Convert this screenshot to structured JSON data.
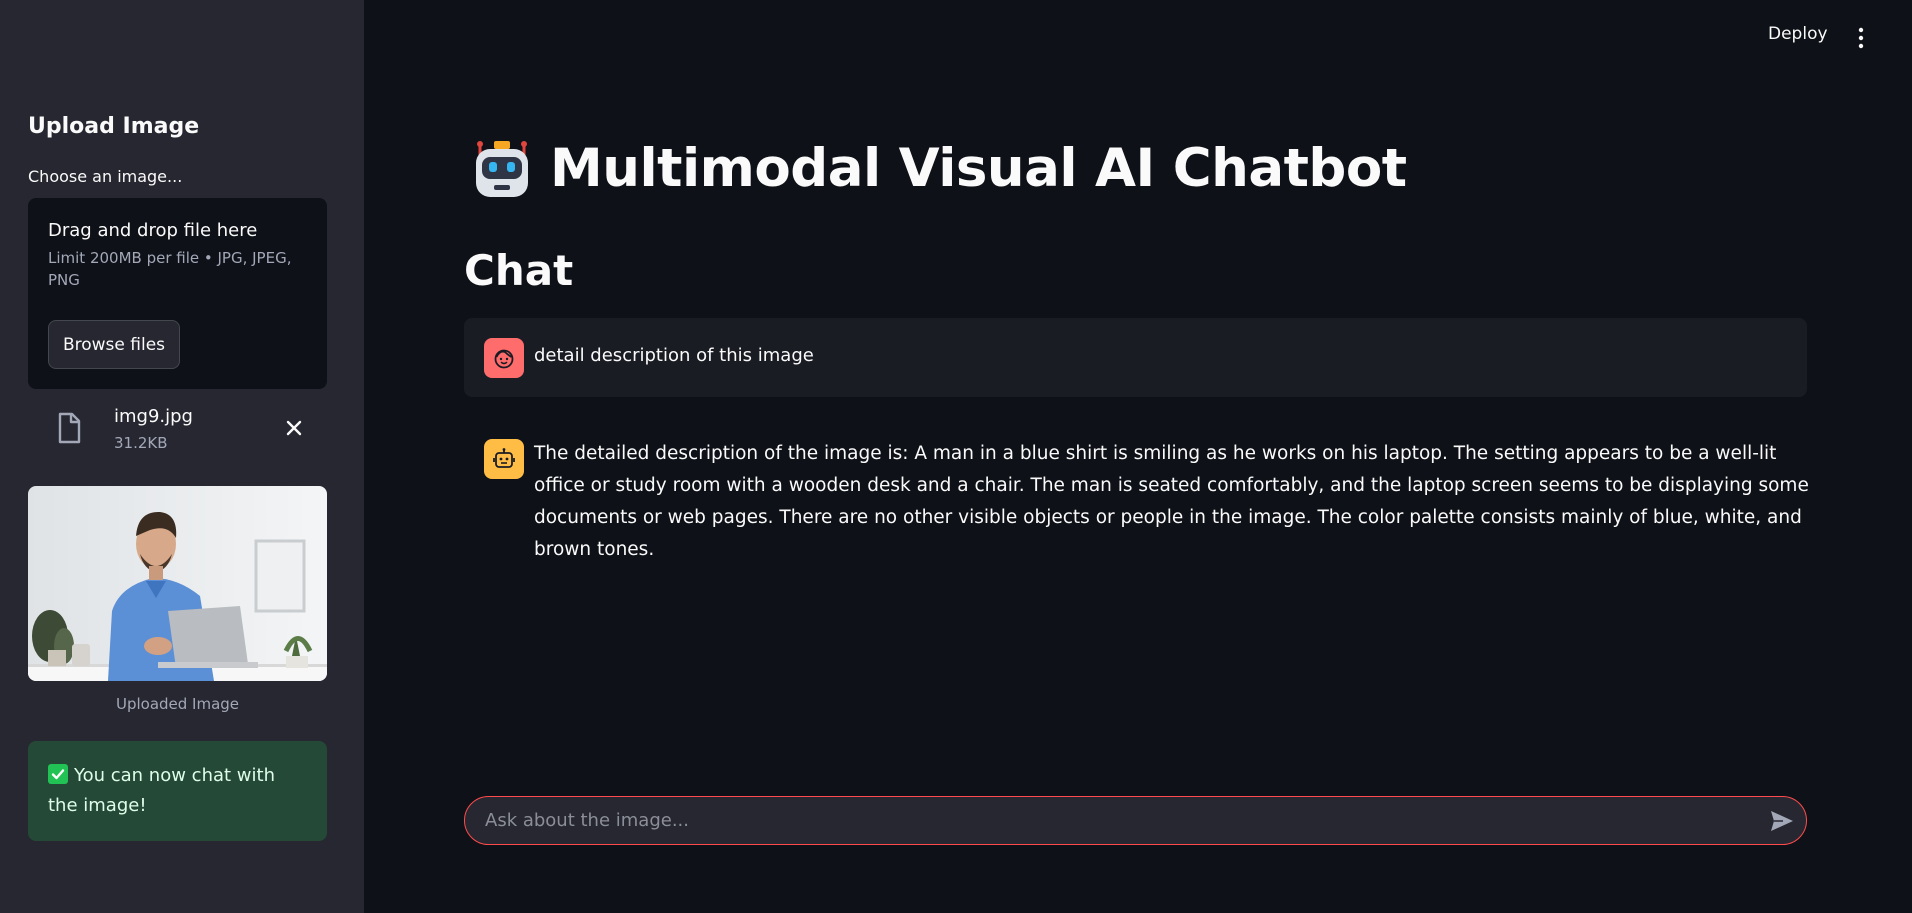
{
  "sidebar": {
    "title": "Upload Image",
    "uploader_label": "Choose an image...",
    "dropzone": {
      "title": "Drag and drop file here",
      "limit": "Limit 200MB per file • JPG, JPEG, PNG",
      "browse_label": "Browse files"
    },
    "file": {
      "name": "img9.jpg",
      "size": "31.2KB"
    },
    "preview_caption": "Uploaded Image",
    "success_message": "You can now chat with the image!"
  },
  "header": {
    "deploy_label": "Deploy"
  },
  "main": {
    "title": "Multimodal Visual AI Chatbot",
    "chat_heading": "Chat",
    "messages": [
      {
        "role": "user",
        "text": "detail description of this image"
      },
      {
        "role": "assistant",
        "text": "The detailed description of the image is: A man in a blue shirt is smiling as he works on his laptop. The setting appears to be a well-lit office or study room with a wooden desk and a chair. The man is seated comfortably, and the laptop screen seems to be displaying some documents or web pages. There are no other visible objects or people in the image. The color palette consists mainly of blue, white, and brown tones."
      }
    ],
    "input_placeholder": "Ask about the image..."
  },
  "colors": {
    "accent": "#ff4b4b",
    "sidebar_bg": "#262730",
    "main_bg": "#0e1117",
    "user_avatar": "#ff6c6c",
    "bot_avatar": "#ffbd45",
    "success": "#21c354"
  }
}
